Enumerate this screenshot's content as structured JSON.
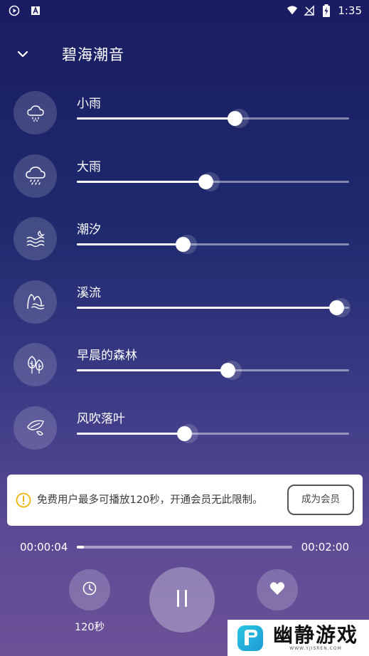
{
  "status_bar": {
    "time": "1:35"
  },
  "header": {
    "title": "碧海潮音"
  },
  "sounds": [
    {
      "name": "小雨",
      "level": 0.58,
      "icon": "light-rain-icon"
    },
    {
      "name": "大雨",
      "level": 0.475,
      "icon": "heavy-rain-icon"
    },
    {
      "name": "潮汐",
      "level": 0.39,
      "icon": "tide-icon"
    },
    {
      "name": "溪流",
      "level": 0.955,
      "icon": "stream-icon"
    },
    {
      "name": "早晨的森林",
      "level": 0.555,
      "icon": "forest-icon"
    },
    {
      "name": "风吹落叶",
      "level": 0.395,
      "icon": "leaf-icon"
    }
  ],
  "notice": {
    "text": "免费用户最多可播放120秒，开通会员无此限制。",
    "button": "成为会员"
  },
  "player": {
    "current_time": "00:00:04",
    "total_time": "00:02:00",
    "progress": 0.033,
    "timer_label": "120秒"
  },
  "watermark": {
    "main": "幽静游戏",
    "sub": "WWW.YJISREN.COM"
  },
  "colors": {
    "background_top": "#1a1c62",
    "background_bottom": "#6d5198",
    "accent": "#ffffff"
  }
}
